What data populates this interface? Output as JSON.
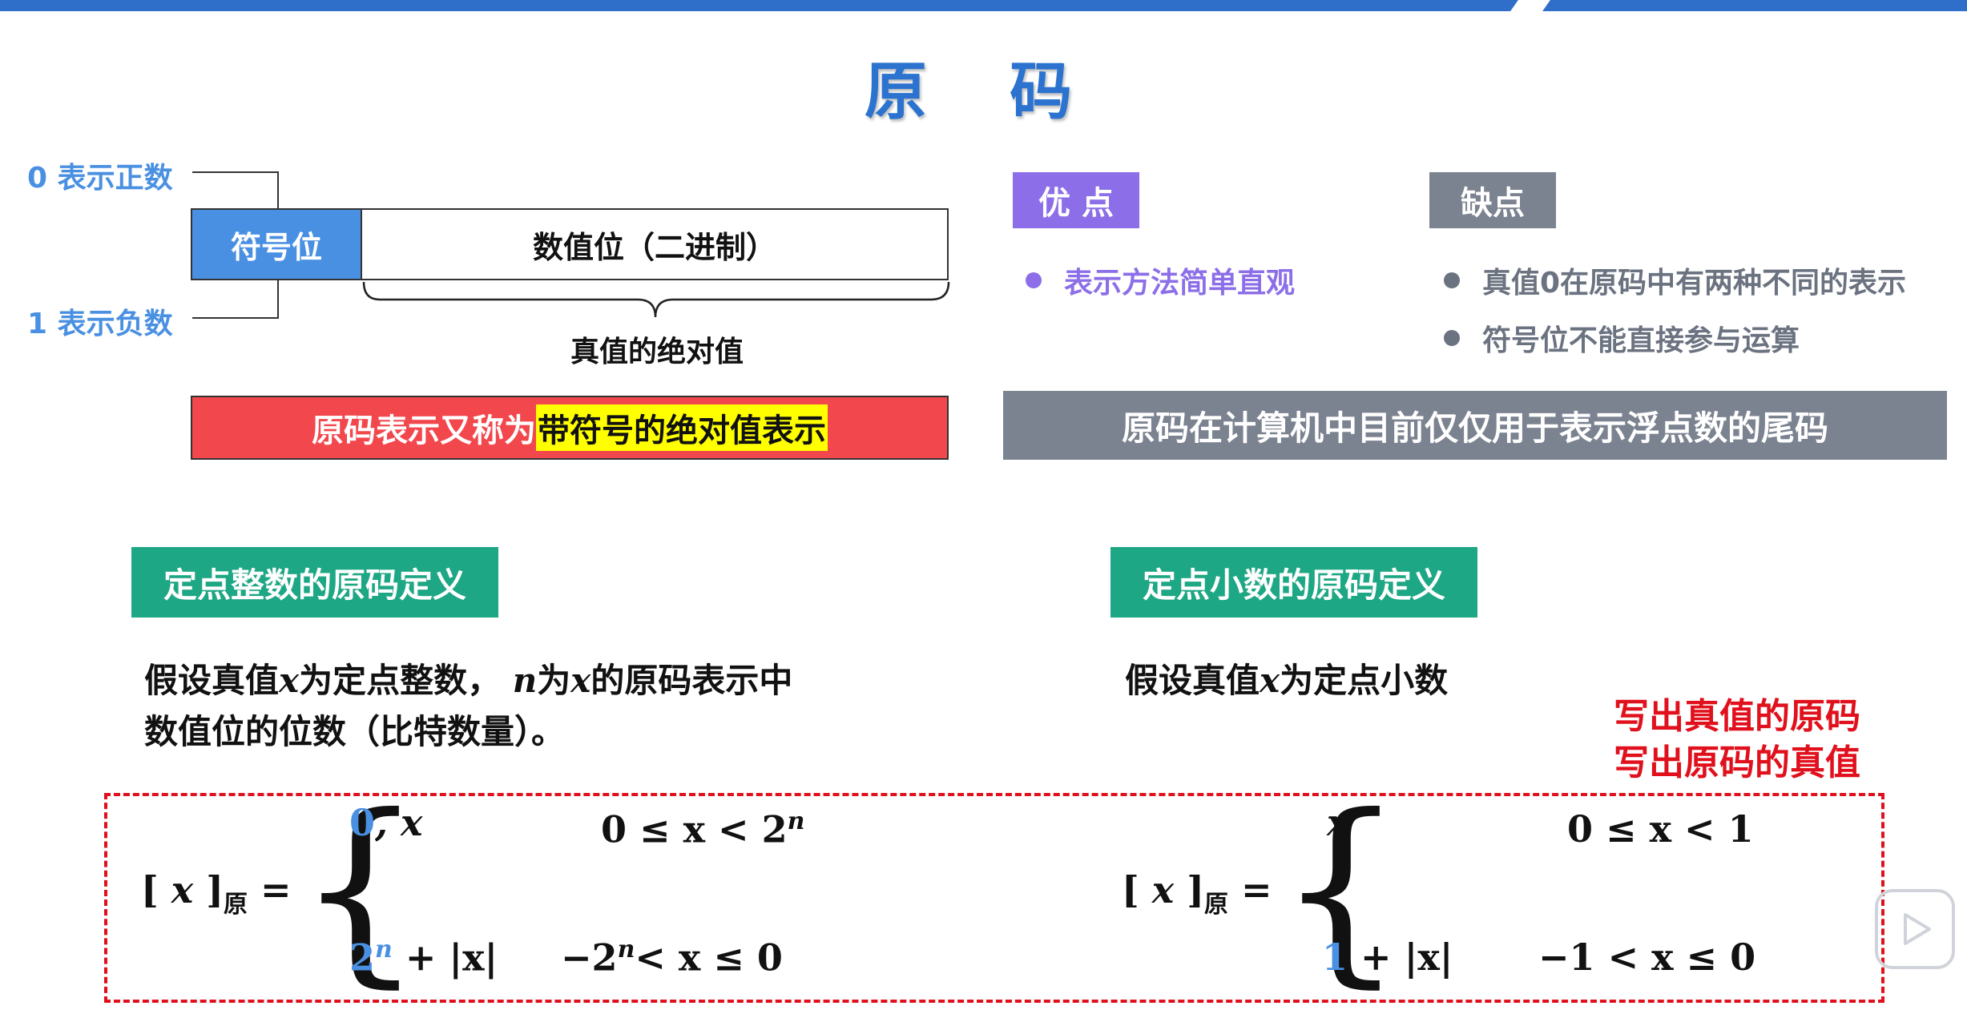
{
  "slide": {
    "title": "原 码"
  },
  "diagram": {
    "positive_label": "0 表示正数",
    "negative_label": "1 表示负数",
    "sign_bit_label": "符号位",
    "value_bits_label": "数值位（二进制）",
    "abs_value_label": "真值的绝对值"
  },
  "banners": {
    "red_prefix": "原码表示又称为",
    "red_highlight": "带符号的绝对值表示",
    "gray": "原码在计算机中目前仅仅用于表示浮点数的尾码"
  },
  "pros": {
    "label": "优 点",
    "items": [
      "表示方法简单直观"
    ]
  },
  "cons": {
    "label": "缺点",
    "items": [
      "真值0在原码中有两种不同的表示",
      "符号位不能直接参与运算"
    ]
  },
  "integer_def": {
    "label": "定点整数的原码定义",
    "line1_a": "假设真值",
    "line1_x": "x",
    "line1_b": "为定点整数，",
    "line1_n": "n",
    "line1_c": "为",
    "line1_x2": "x",
    "line1_d": "的原码表示中",
    "line2": "数值位的位数（比特数量）。"
  },
  "fraction_def": {
    "label": "定点小数的原码定义",
    "text_a": "假设真值",
    "text_x": "x",
    "text_b": "为定点小数"
  },
  "red_note": {
    "line1": "写出真值的原码",
    "line2": "写出原码的真值"
  },
  "formulas": {
    "subscript": "原",
    "integer": {
      "case1_value_blue": "0",
      "case1_value_rest": ", x",
      "case1_cond": "0 ≤ x < 2",
      "case1_cond_exp": "n",
      "case2_value_blue": "2",
      "case2_value_exp": "n",
      "case2_value_rest": " + |x|",
      "case2_cond_a": "−2",
      "case2_cond_exp": "n",
      "case2_cond_b": "< x ≤ 0"
    },
    "fraction": {
      "case1_value": "x",
      "case1_cond": "0 ≤ x < 1",
      "case2_value_blue": "1",
      "case2_value_rest": " + |x|",
      "case2_cond": "−1 < x ≤ 0"
    }
  },
  "icons": {
    "play": "play-icon"
  }
}
